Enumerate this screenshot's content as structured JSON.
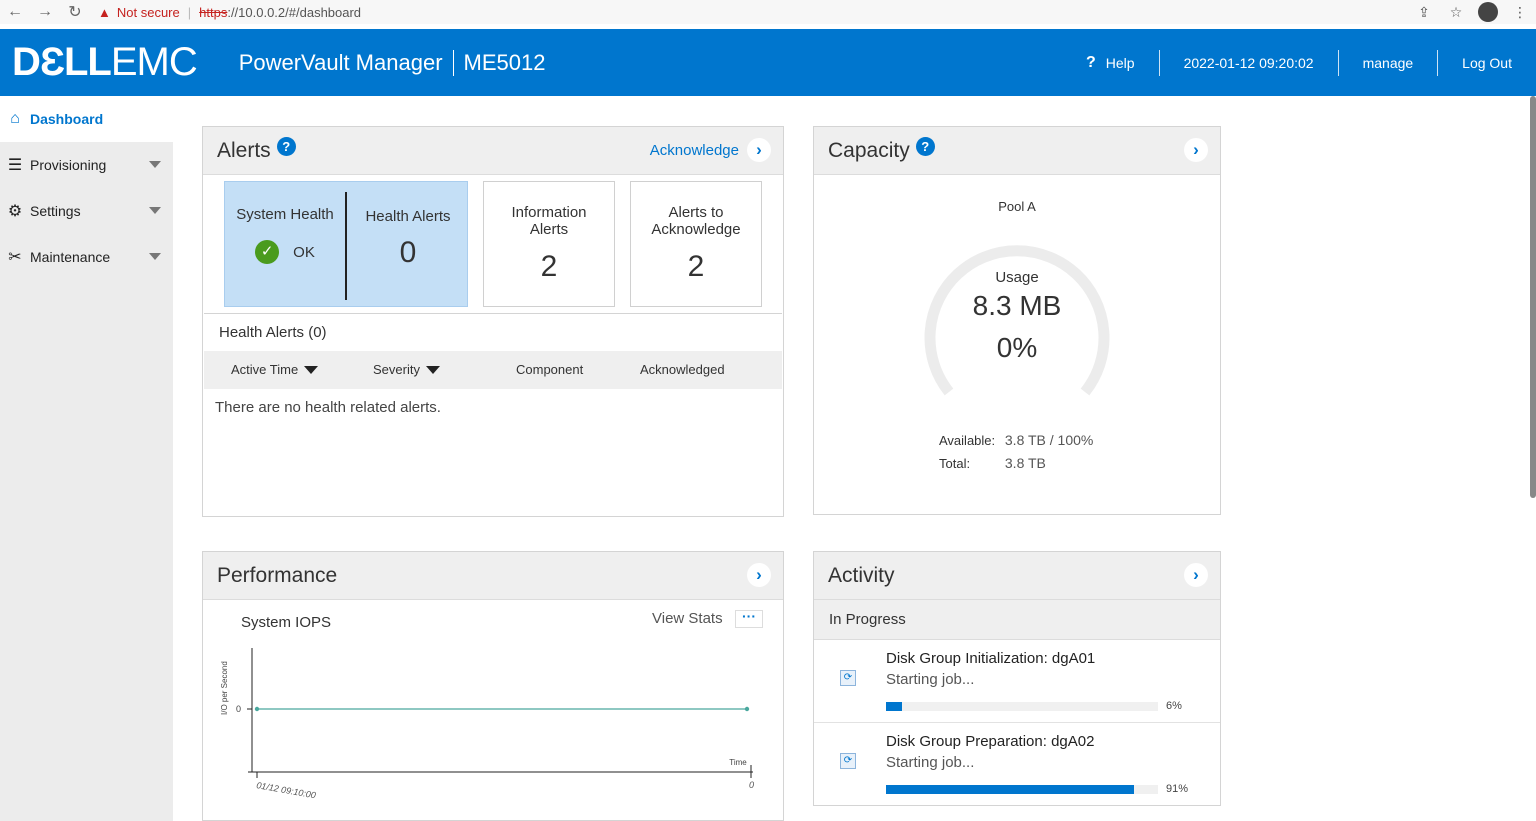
{
  "browser": {
    "not_secure": "Not secure",
    "url_scheme": "https",
    "url_rest": "://10.0.0.2/#/dashboard"
  },
  "header": {
    "logo_dell": "DƐLL",
    "logo_emc": "EMC",
    "product": "PowerVault Manager",
    "model": "ME5012",
    "help": "Help",
    "datetime": "2022-01-12 09:20:02",
    "user": "manage",
    "logout": "Log Out"
  },
  "sidebar": {
    "items": [
      {
        "label": "Dashboard",
        "icon": "home-icon"
      },
      {
        "label": "Provisioning",
        "icon": "database-icon"
      },
      {
        "label": "Settings",
        "icon": "gear-icon"
      },
      {
        "label": "Maintenance",
        "icon": "tools-icon"
      }
    ]
  },
  "alerts": {
    "title": "Alerts",
    "acknowledge": "Acknowledge",
    "system_health_label": "System Health",
    "system_health_value": "OK",
    "health_alerts_label": "Health Alerts",
    "health_alerts_count": "0",
    "info_alerts_label": "Information Alerts",
    "info_alerts_count": "2",
    "ack_alerts_label": "Alerts to Acknowledge",
    "ack_alerts_count": "2",
    "table_title": "Health Alerts (0)",
    "columns": [
      "Active Time",
      "Severity",
      "Component",
      "Acknowledged"
    ],
    "empty_message": "There are no health related alerts."
  },
  "capacity": {
    "title": "Capacity",
    "pool": "Pool A",
    "usage_label": "Usage",
    "usage_value": "8.3 MB",
    "usage_percent": "0%",
    "available_label": "Available:",
    "available_value": "3.8 TB / 100%",
    "total_label": "Total:",
    "total_value": "3.8 TB"
  },
  "performance": {
    "title": "Performance",
    "chart_title": "System IOPS",
    "view_stats": "View Stats",
    "chart_data": {
      "type": "line",
      "title": "System IOPS",
      "ylabel": "I/O per Second",
      "xlabel": "Time",
      "y_ticks": [
        "0"
      ],
      "x_tick_start": "01/12 09:10:00",
      "x_tick_end": "0",
      "series": [
        {
          "values": [
            0,
            0
          ]
        }
      ]
    }
  },
  "activity": {
    "title": "Activity",
    "subheader": "In Progress",
    "jobs": [
      {
        "title": "Disk Group Initialization: dgA01",
        "status": "Starting job...",
        "percent_label": "6%",
        "percent": 6
      },
      {
        "title": "Disk Group Preparation: dgA02",
        "status": "Starting job...",
        "percent_label": "91%",
        "percent": 91
      }
    ]
  },
  "colors": {
    "brand": "#0076ce",
    "ok": "#4a9b1e",
    "chart_line": "#4aa89e"
  }
}
